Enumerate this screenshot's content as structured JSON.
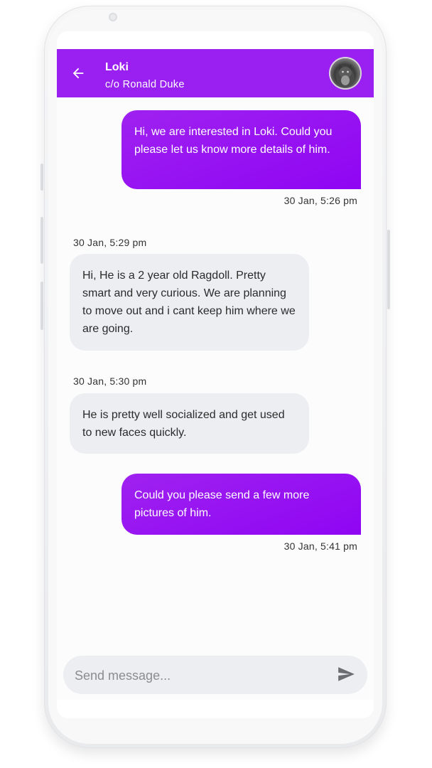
{
  "header": {
    "title": "Loki",
    "subtitle": "c/o Ronald Duke"
  },
  "messages": [
    {
      "direction": "out",
      "text": "Hi, we are interested in Loki. Could you please let us know more details of him.",
      "time": "30 Jan, 5:26 pm"
    },
    {
      "direction": "in",
      "text": "Hi, He is a 2 year old Ragdoll. Pretty smart and very curious. We are planning to move out and i cant keep him where we are going.",
      "time": "30 Jan, 5:29 pm"
    },
    {
      "direction": "in",
      "text": "He is pretty well socialized and get used to new faces quickly.",
      "time": "30 Jan, 5:30 pm"
    },
    {
      "direction": "out",
      "text": "Could you please send a few more pictures of him.",
      "time": "30 Jan, 5:41 pm"
    }
  ],
  "composer": {
    "placeholder": "Send message..."
  },
  "colors": {
    "accent": "#9a1ff1",
    "outgoing_bubble": "#9405f2",
    "incoming_bubble": "#eceef2"
  },
  "icons": {
    "back": "arrow-left-icon",
    "send": "send-icon",
    "avatar": "cat-avatar"
  }
}
